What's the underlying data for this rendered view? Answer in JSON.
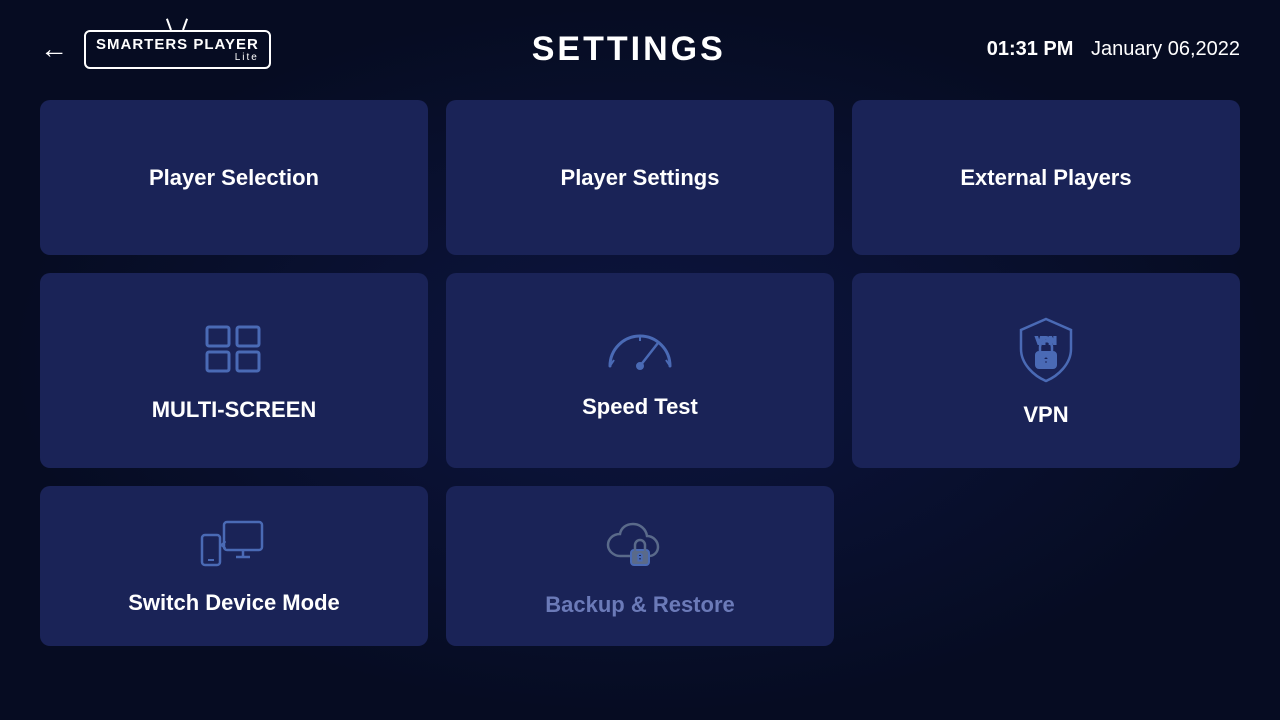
{
  "header": {
    "back_label": "←",
    "logo_text": "SMARTERS PLAYER",
    "logo_lite": "Lite",
    "title": "SETTINGS",
    "time": "01:31 PM",
    "date": "January 06,2022"
  },
  "tiles": {
    "row1": [
      {
        "id": "player-selection",
        "label": "Player Selection",
        "icon": "none"
      },
      {
        "id": "player-settings",
        "label": "Player Settings",
        "icon": "none"
      },
      {
        "id": "external-players",
        "label": "External Players",
        "icon": "none"
      }
    ],
    "row2": [
      {
        "id": "multi-screen",
        "label": "MULTI-SCREEN",
        "icon": "multiscreen"
      },
      {
        "id": "speed-test",
        "label": "Speed Test",
        "icon": "speedtest"
      },
      {
        "id": "vpn",
        "label": "VPN",
        "icon": "vpn"
      }
    ],
    "row3": [
      {
        "id": "switch-device-mode",
        "label": "Switch Device Mode",
        "icon": "switchdevice"
      },
      {
        "id": "backup-restore",
        "label": "Backup & Restore",
        "icon": "backup",
        "muted": true
      }
    ]
  }
}
